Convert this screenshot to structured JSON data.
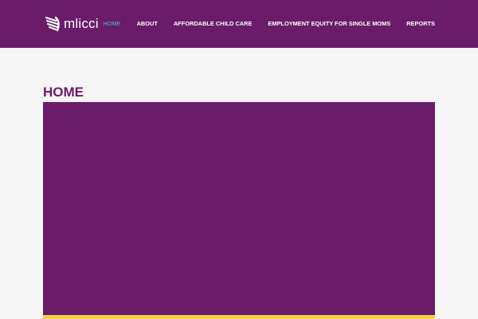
{
  "brand": {
    "logo_text": "mlicci"
  },
  "nav": {
    "items": [
      {
        "label": "HOME",
        "active": true
      },
      {
        "label": "ABOUT",
        "active": false
      },
      {
        "label": "AFFORDABLE CHILD CARE",
        "active": false
      },
      {
        "label": "EMPLOYMENT EQUITY FOR SINGLE MOMS",
        "active": false
      },
      {
        "label": "REPORTS",
        "active": false
      }
    ]
  },
  "page": {
    "title": "HOME"
  },
  "colors": {
    "brand_purple": "#6a1b6a",
    "nav_active": "#4fb7c9",
    "accent_yellow": "#f1cf4a",
    "background": "#f7f6f6"
  },
  "icons": {
    "logo_mark": "hands-logo-icon"
  }
}
